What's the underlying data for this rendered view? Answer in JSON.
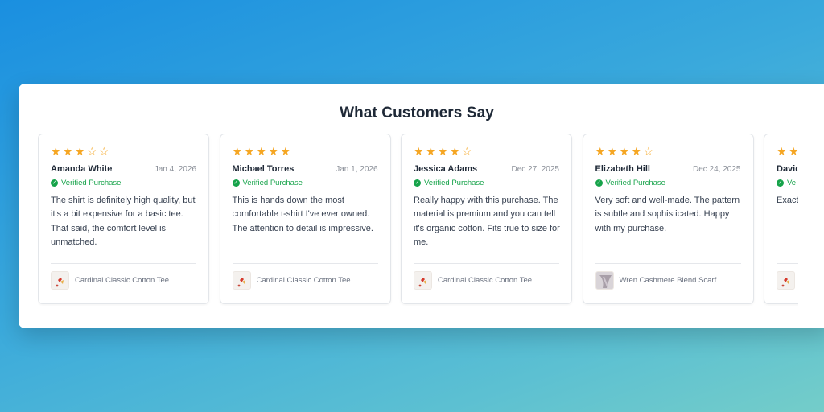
{
  "header": {
    "title": "What Customers Say"
  },
  "colors": {
    "star": "#f5a623",
    "verified": "#16a34a"
  },
  "reviews": [
    {
      "rating": 3,
      "name": "Amanda White",
      "date": "Jan 4, 2026",
      "verified": "Verified Purchase",
      "text": "The shirt is definitely high quality, but it's a bit expensive for a basic tee. That said, the comfort level is unmatched.",
      "product": "Cardinal Classic Cotton Tee",
      "thumb_icon": "cardinal-tee-thumbnail"
    },
    {
      "rating": 5,
      "name": "Michael Torres",
      "date": "Jan 1, 2026",
      "verified": "Verified Purchase",
      "text": "This is hands down the most comfortable t-shirt I've ever owned. The attention to detail is impressive.",
      "product": "Cardinal Classic Cotton Tee",
      "thumb_icon": "cardinal-tee-thumbnail"
    },
    {
      "rating": 4,
      "name": "Jessica Adams",
      "date": "Dec 27, 2025",
      "verified": "Verified Purchase",
      "text": "Really happy with this purchase. The material is premium and you can tell it's organic cotton. Fits true to size for me.",
      "product": "Cardinal Classic Cotton Tee",
      "thumb_icon": "cardinal-tee-thumbnail"
    },
    {
      "rating": 4,
      "name": "Elizabeth Hill",
      "date": "Dec 24, 2025",
      "verified": "Verified Purchase",
      "text": "Very soft and well-made. The pattern is subtle and sophisticated. Happy with my purchase.",
      "product": "Wren Cashmere Blend Scarf",
      "thumb_icon": "wren-scarf-thumbnail"
    },
    {
      "rating": 2,
      "name": "David",
      "date": "",
      "verified": "Ve",
      "text": "Exact Comf desig Alrea",
      "product": "",
      "thumb_icon": "cardinal-tee-thumbnail"
    }
  ]
}
